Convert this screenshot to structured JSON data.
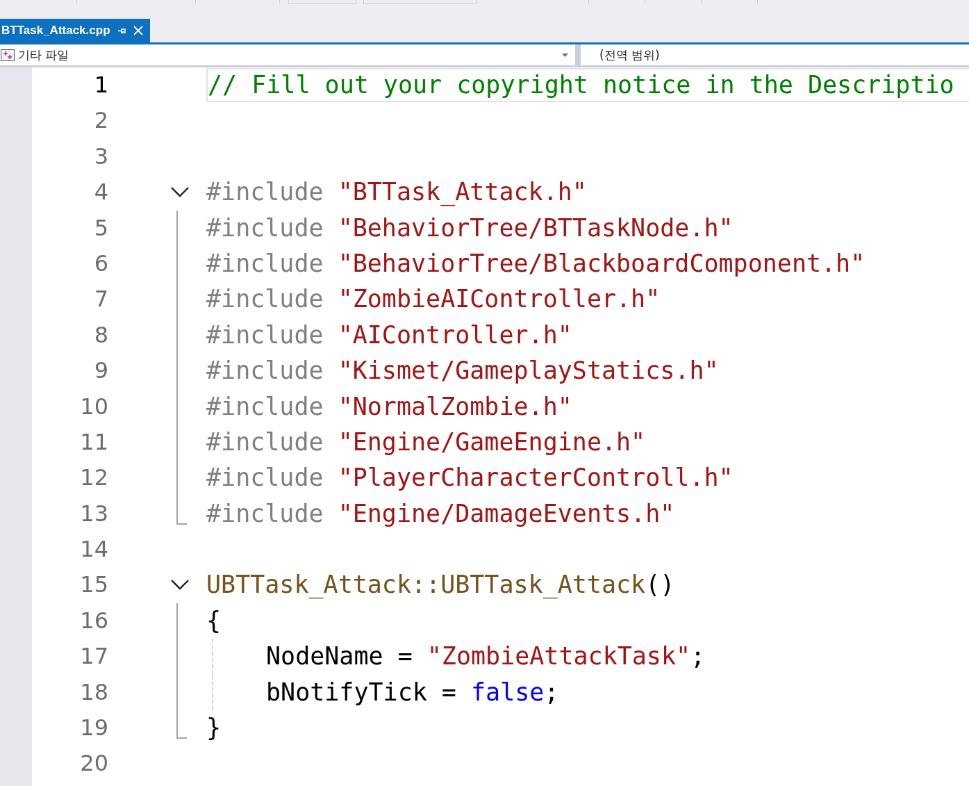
{
  "tab": {
    "title": "BTTask_Attack.cpp",
    "selected": true
  },
  "navigation": {
    "project": "기타 파일",
    "scope": "(전역 범위)"
  },
  "lines": [
    {
      "number": "1",
      "current": true,
      "tokens": [
        {
          "kind": "comment",
          "text": "// Fill out your copyright notice in the Descriptio"
        }
      ]
    },
    {
      "number": "2",
      "current": false
    },
    {
      "number": "3",
      "current": false
    },
    {
      "number": "4",
      "current": false,
      "expanded": true,
      "tokens": [
        {
          "kind": "preprocessor",
          "text": "#include "
        },
        {
          "kind": "string",
          "text": "\"BTTask_Attack.h\""
        }
      ],
      "children": [
        {
          "number": "5",
          "current": false,
          "tokens": [
            {
              "kind": "preprocessor",
              "text": "#include "
            },
            {
              "kind": "string",
              "text": "\"BehaviorTree/BTTaskNode.h\""
            }
          ]
        },
        {
          "number": "6",
          "current": false,
          "tokens": [
            {
              "kind": "preprocessor",
              "text": "#include "
            },
            {
              "kind": "string",
              "text": "\"BehaviorTree/BlackboardComponent.h\""
            }
          ]
        },
        {
          "number": "7",
          "current": false,
          "tokens": [
            {
              "kind": "preprocessor",
              "text": "#include "
            },
            {
              "kind": "string",
              "text": "\"ZombieAIController.h\""
            }
          ]
        },
        {
          "number": "8",
          "current": false,
          "tokens": [
            {
              "kind": "preprocessor",
              "text": "#include "
            },
            {
              "kind": "string",
              "text": "\"AIController.h\""
            }
          ]
        },
        {
          "number": "9",
          "current": false,
          "tokens": [
            {
              "kind": "preprocessor",
              "text": "#include "
            },
            {
              "kind": "string",
              "text": "\"Kismet/GameplayStatics.h\""
            }
          ]
        },
        {
          "number": "10",
          "current": false,
          "tokens": [
            {
              "kind": "preprocessor",
              "text": "#include "
            },
            {
              "kind": "string",
              "text": "\"NormalZombie.h\""
            }
          ]
        },
        {
          "number": "11",
          "current": false,
          "tokens": [
            {
              "kind": "preprocessor",
              "text": "#include "
            },
            {
              "kind": "string",
              "text": "\"Engine/GameEngine.h\""
            }
          ]
        },
        {
          "number": "12",
          "current": false,
          "tokens": [
            {
              "kind": "preprocessor",
              "text": "#include "
            },
            {
              "kind": "string",
              "text": "\"PlayerCharacterControll.h\""
            }
          ]
        },
        {
          "number": "13",
          "current": false,
          "tokens": [
            {
              "kind": "preprocessor",
              "text": "#include "
            },
            {
              "kind": "string",
              "text": "\"Engine/DamageEvents.h\""
            }
          ]
        }
      ]
    },
    {
      "number": "14",
      "current": false
    },
    {
      "number": "15",
      "current": false,
      "expanded": true,
      "tokens": [
        {
          "kind": "function",
          "text": "UBTTask_Attack::UBTTask_Attack"
        },
        {
          "kind": "plain",
          "text": "()"
        }
      ],
      "children": [
        {
          "number": "16",
          "current": false,
          "tokens": [
            {
              "kind": "plain",
              "text": "{"
            }
          ]
        },
        {
          "number": "17",
          "current": false,
          "indent_guide": true,
          "tokens": [
            {
              "kind": "plain",
              "text": "NodeName = "
            },
            {
              "kind": "string",
              "text": "\"ZombieAttackTask\""
            },
            {
              "kind": "plain",
              "text": ";"
            }
          ]
        },
        {
          "number": "18",
          "current": false,
          "indent_guide": true,
          "tokens": [
            {
              "kind": "plain",
              "text": "bNotifyTick = "
            },
            {
              "kind": "keyword",
              "text": "false"
            },
            {
              "kind": "plain",
              "text": ";"
            }
          ]
        },
        {
          "number": "19",
          "current": false,
          "tokens": [
            {
              "kind": "plain",
              "text": "}"
            }
          ]
        }
      ]
    },
    {
      "number": "20",
      "current": false
    }
  ]
}
